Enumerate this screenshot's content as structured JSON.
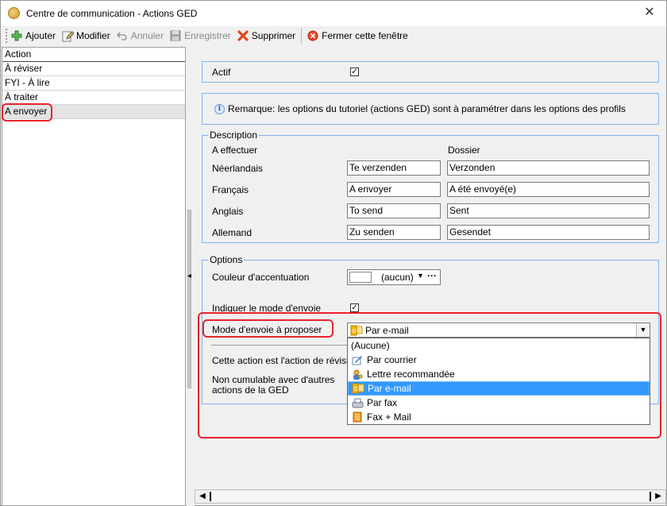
{
  "window": {
    "title": "Centre de communication - Actions GED",
    "close_glyph": "✕"
  },
  "toolbar": {
    "add": "Ajouter",
    "modify": "Modifier",
    "cancel": "Annuler",
    "save": "Enregistrer",
    "delete": "Supprimer",
    "close": "Fermer cette fenêtre"
  },
  "list": {
    "header": "Action",
    "items": [
      "À réviser",
      "FYI - À lire",
      "À traiter",
      "A envoyer"
    ],
    "selected_index": 3
  },
  "form": {
    "actif_label": "Actif",
    "actif_checked": true,
    "remark": "Remarque: les options du tutoriel (actions GED) sont à paramétrer dans les options des profils",
    "description": {
      "group_label": "Description",
      "col1_header": "A effectuer",
      "col2_header": "Dossier",
      "rows": [
        {
          "lang": "Néerlandais",
          "effectuer": "Te verzenden",
          "dossier": "Verzonden"
        },
        {
          "lang": "Français",
          "effectuer": "A envoyer",
          "dossier": "A été envoyé(e)"
        },
        {
          "lang": "Anglais",
          "effectuer": "To send",
          "dossier": "Sent"
        },
        {
          "lang": "Allemand",
          "effectuer": "Zu senden",
          "dossier": "Gesendet"
        }
      ]
    },
    "options": {
      "group_label": "Options",
      "accent_label": "Couleur d'accentuation",
      "accent_value": "(aucun)",
      "indicate_mode_label": "Indiquer le mode d'envoie",
      "indicate_mode_checked": true,
      "mode_label": "Mode d'envoie à proposer",
      "mode_selected": "Par e-mail",
      "revision_label": "Cette action est l'action de révision",
      "non_cumul_label_1": "Non cumulable avec d'autres",
      "non_cumul_label_2": "actions de la GED"
    },
    "mode_options": [
      {
        "label": "(Aucune)",
        "icon": "none"
      },
      {
        "label": "Par courrier",
        "icon": "letter-pen-icon"
      },
      {
        "label": "Lettre recommandée",
        "icon": "person-key-icon"
      },
      {
        "label": "Par e-mail",
        "icon": "outlook-mail-icon"
      },
      {
        "label": "Par fax",
        "icon": "fax-icon"
      },
      {
        "label": "Fax + Mail",
        "icon": "fax-mail-icon"
      }
    ],
    "highlighted_option_index": 3
  },
  "colors": {
    "group_border": "#7eb4ea",
    "highlight": "#3399ff",
    "annotation_red": "#e8232b"
  }
}
